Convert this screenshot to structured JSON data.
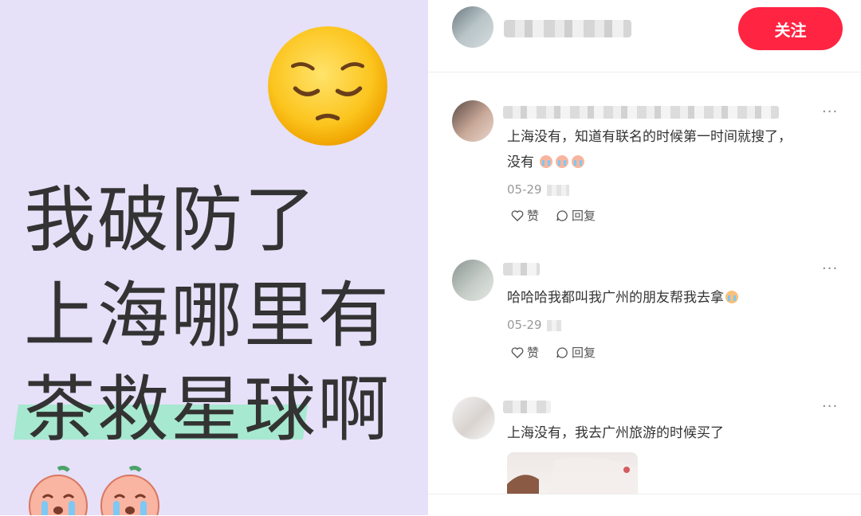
{
  "left_panel": {
    "lines": [
      "我破防了",
      "上海哪里有",
      "茶救星球啊"
    ],
    "background": "#e6e0f8",
    "highlight_color": "#a7e8d0"
  },
  "header": {
    "follow_label": "关注",
    "follow_color": "#ff2442"
  },
  "comments": [
    {
      "text_line1": "上海没有，知道有联名的时候第一时间就搜了，",
      "text_line2": "没有",
      "date": "05-29",
      "like_label": "赞",
      "reply_label": "回复"
    },
    {
      "text": "哈哈哈我都叫我广州的朋友帮我去拿",
      "date": "05-29",
      "like_label": "赞",
      "reply_label": "回复"
    },
    {
      "text": "上海没有，我去广州旅游的时候买了"
    }
  ],
  "icons": [
    "pensive-face-emoji",
    "crying-peach-emoji",
    "heart-icon",
    "comment-bubble-icon",
    "more-icon"
  ]
}
